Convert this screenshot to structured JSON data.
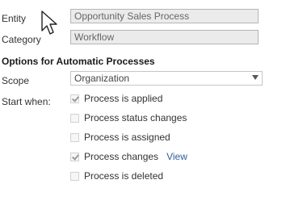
{
  "fields": {
    "entity_label": "Entity",
    "entity_value": "Opportunity Sales Process",
    "category_label": "Category",
    "category_value": "Workflow"
  },
  "section": {
    "title": "Options for Automatic Processes"
  },
  "scope": {
    "label": "Scope",
    "selected": "Organization"
  },
  "start_when": {
    "label": "Start when:",
    "options": [
      {
        "label": "Process is applied",
        "checked": true
      },
      {
        "label": "Process status changes",
        "checked": false
      },
      {
        "label": "Process is assigned",
        "checked": false
      },
      {
        "label": "Process changes",
        "checked": true,
        "link": "View"
      },
      {
        "label": "Process is deleted",
        "checked": false
      }
    ]
  },
  "icons": {
    "cursor": "mouse-pointer-icon",
    "dropdown": "chevron-down-icon",
    "checkmark": "checkmark-icon"
  }
}
